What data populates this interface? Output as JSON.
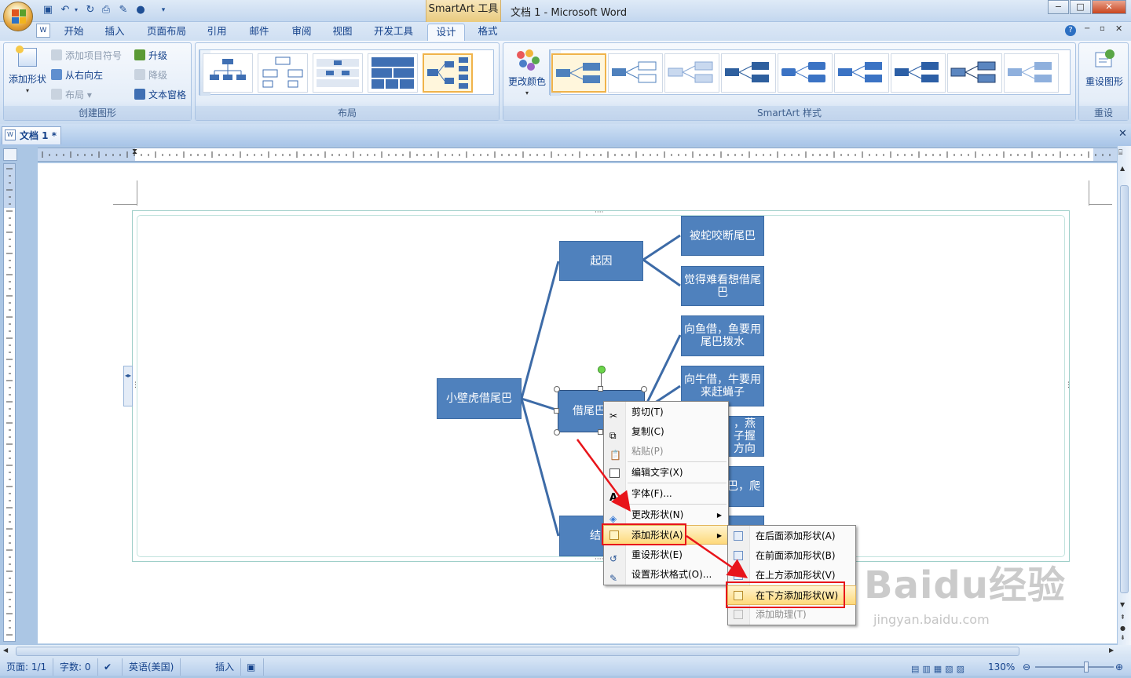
{
  "window": {
    "contextual_tab_title": "SmartArt 工具",
    "doc_title": "文档 1 - Microsoft Word",
    "minimize": "−",
    "maximize": "□",
    "close": "✕"
  },
  "tabs": [
    "开始",
    "插入",
    "页面布局",
    "引用",
    "邮件",
    "审阅",
    "视图",
    "开发工具",
    "设计",
    "格式"
  ],
  "active_tab": "设计",
  "ribbon": {
    "group_create": {
      "label": "创建图形",
      "add_shape": "添加形状",
      "add_bullet": "添加项目符号",
      "right_to_left": "从右向左",
      "layout": "布局",
      "promote": "升级",
      "demote": "降级",
      "text_pane": "文本窗格"
    },
    "group_layouts": {
      "label": "布局"
    },
    "group_styles": {
      "label": "SmartArt 样式",
      "change_colors": "更改颜色"
    },
    "group_reset": {
      "label": "重设",
      "reset_graphic": "重设图形"
    }
  },
  "document_tab": "文档 1 *",
  "smartart": {
    "root": "小壁虎借尾巴",
    "level1": [
      "起因",
      "借尾巴",
      "结"
    ],
    "level2": [
      "被蛇咬断尾巴",
      "觉得难看想借尾巴",
      "向鱼借，鱼要用尾巴拨水",
      "向牛借，牛要用来赶蝇子",
      "，燕子握方向",
      "巴，爬"
    ]
  },
  "context_menu": {
    "items": [
      {
        "label": "剪切(T)",
        "enabled": true
      },
      {
        "label": "复制(C)",
        "enabled": true
      },
      {
        "label": "粘贴(P)",
        "enabled": false
      },
      {
        "label": "编辑文字(X)",
        "enabled": true
      },
      {
        "label": "字体(F)...",
        "enabled": true
      },
      {
        "label": "更改形状(N)",
        "enabled": true
      },
      {
        "label": "添加形状(A)",
        "enabled": true
      },
      {
        "label": "重设形状(E)",
        "enabled": true
      },
      {
        "label": "设置形状格式(O)...",
        "enabled": true
      }
    ]
  },
  "submenu": {
    "items": [
      {
        "label": "在后面添加形状(A)",
        "enabled": true
      },
      {
        "label": "在前面添加形状(B)",
        "enabled": true
      },
      {
        "label": "在上方添加形状(V)",
        "enabled": true
      },
      {
        "label": "在下方添加形状(W)",
        "enabled": true
      },
      {
        "label": "添加助理(T)",
        "enabled": false
      }
    ]
  },
  "statusbar": {
    "page": "页面: 1/1",
    "words": "字数: 0",
    "language": "英语(美国)",
    "mode": "插入",
    "zoom": "130%"
  },
  "watermark": {
    "brand": "Baidu经验",
    "url": "jingyan.baidu.com"
  },
  "colors": {
    "node": "#4f81bd",
    "highlight_box": "#e8141a",
    "arrow": "#e8141a"
  }
}
